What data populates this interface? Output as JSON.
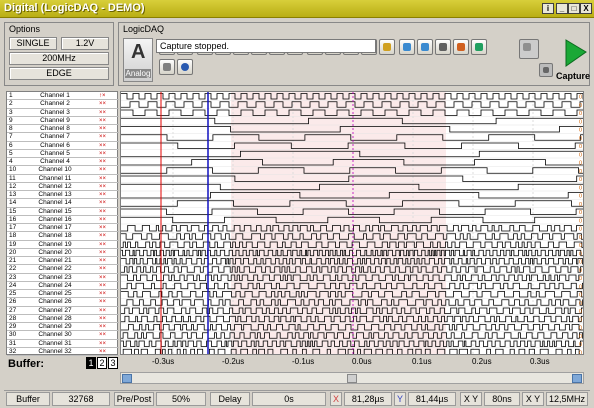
{
  "window": {
    "title": "Digital (LogicDAQ - DEMO)",
    "controls": [
      "i",
      "_",
      "□",
      "X"
    ]
  },
  "options": {
    "header": "Options",
    "mode": "SINGLE",
    "voltage": "1.2V",
    "rate": "200MHz",
    "trigger": "EDGE"
  },
  "device": {
    "header": "LogicDAQ",
    "analog_label": "Analog",
    "status_message": "Capture stopped.",
    "capture_label": "Capture"
  },
  "channels": [
    {
      "n": "1",
      "name": "Channel 1",
      "mark": "↑×"
    },
    {
      "n": "2",
      "name": "Channel 2",
      "mark": "××"
    },
    {
      "n": "3",
      "name": "Channel 3",
      "mark": "××"
    },
    {
      "n": "9",
      "name": "Channel 9",
      "mark": "××"
    },
    {
      "n": "8",
      "name": "Channel 8",
      "mark": "××"
    },
    {
      "n": "7",
      "name": "Channel 7",
      "mark": "××"
    },
    {
      "n": "6",
      "name": "Channel 6",
      "mark": "××"
    },
    {
      "n": "5",
      "name": "Channel 5",
      "mark": "××"
    },
    {
      "n": "4",
      "name": "Channel 4",
      "mark": "××"
    },
    {
      "n": "10",
      "name": "Channel 10",
      "mark": "××"
    },
    {
      "n": "11",
      "name": "Channel 11",
      "mark": "××"
    },
    {
      "n": "12",
      "name": "Channel 12",
      "mark": "××"
    },
    {
      "n": "13",
      "name": "Channel 13",
      "mark": "××"
    },
    {
      "n": "14",
      "name": "Channel 14",
      "mark": "××"
    },
    {
      "n": "15",
      "name": "Channel 15",
      "mark": "××"
    },
    {
      "n": "16",
      "name": "Channel 16",
      "mark": "××"
    },
    {
      "n": "17",
      "name": "Channel 17",
      "mark": "××"
    },
    {
      "n": "18",
      "name": "Channel 18",
      "mark": "××"
    },
    {
      "n": "19",
      "name": "Channel 19",
      "mark": "××"
    },
    {
      "n": "20",
      "name": "Channel 20",
      "mark": "××"
    },
    {
      "n": "21",
      "name": "Channel 21",
      "mark": "××"
    },
    {
      "n": "22",
      "name": "Channel 22",
      "mark": "××"
    },
    {
      "n": "23",
      "name": "Channel 23",
      "mark": "××"
    },
    {
      "n": "24",
      "name": "Channel 24",
      "mark": "××"
    },
    {
      "n": "25",
      "name": "Channel 25",
      "mark": "××"
    },
    {
      "n": "26",
      "name": "Channel 26",
      "mark": "××"
    },
    {
      "n": "27",
      "name": "Channel 27",
      "mark": "××"
    },
    {
      "n": "28",
      "name": "Channel 28",
      "mark": "××"
    },
    {
      "n": "29",
      "name": "Channel 29",
      "mark": "××"
    },
    {
      "n": "30",
      "name": "Channel 30",
      "mark": "××"
    },
    {
      "n": "31",
      "name": "Channel 31",
      "mark": "××"
    },
    {
      "n": "32",
      "name": "Channel 32",
      "mark": "××"
    }
  ],
  "buffer": {
    "label": "Buffer:",
    "options": [
      "1",
      "2",
      "3"
    ],
    "selected": "1"
  },
  "time_axis": [
    "-0.3us",
    "-0.2us",
    "-0.1us",
    "0.0us",
    "0.1us",
    "0.2us",
    "0.3us"
  ],
  "statusbar": {
    "buffer_label": "Buffer",
    "buffer_value": "32768",
    "prepost_label": "Pre/Post",
    "prepost_value": "50%",
    "delay_label": "Delay",
    "delay_value": "0s",
    "x_label": "X",
    "x_value": "81,28µs",
    "y_label": "Y",
    "y_value": "81,44µs",
    "xy_label": "X Y",
    "xy_value": "80ns",
    "freq_label": "X Y",
    "freq_value": "12,5MHz"
  },
  "colors": {
    "title_bar": "#c7bd22",
    "cursor_x": "#e00000",
    "cursor_y": "#1010c0",
    "trigger": "#c000c0",
    "signal": "#000000"
  }
}
